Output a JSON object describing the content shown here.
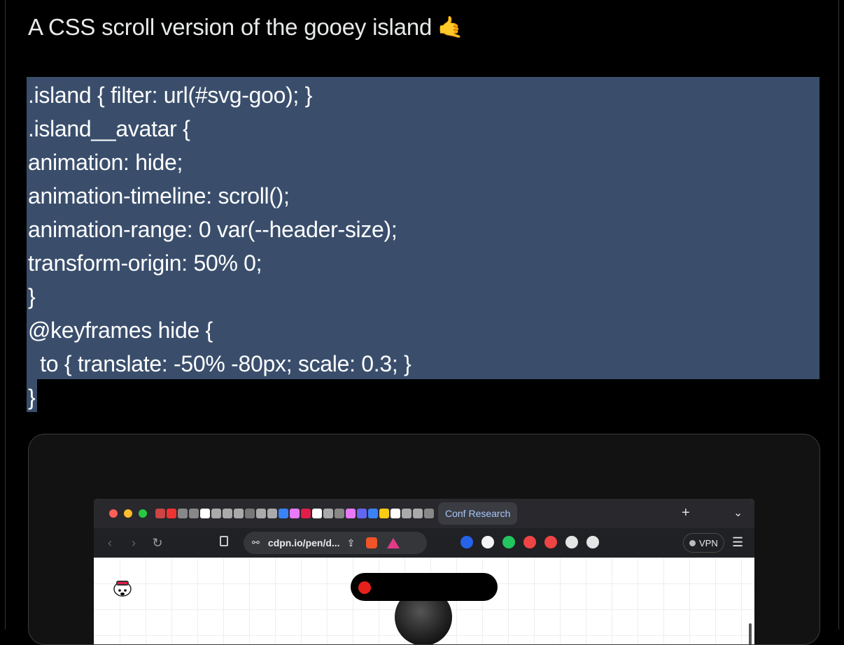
{
  "post": {
    "title": "A CSS scroll version of the gooey island",
    "emoji": "🤙"
  },
  "code_lines": [
    ".island { filter: url(#svg-goo); }",
    ".island__avatar {",
    "animation: hide;",
    "animation-timeline: scroll();",
    "animation-range: 0 var(--header-size);",
    "transform-origin: 50% 0;",
    "}",
    "@keyframes hide {",
    "  to { translate: -50% -80px; scale: 0.3; }",
    "}"
  ],
  "browser": {
    "active_tab_label": "Conf Research",
    "new_tab": "+",
    "tab_list": "⌄",
    "url": "cdpn.io/pen/d...",
    "vpn_label": "VPN",
    "nav": {
      "back": "‹",
      "forward": "›",
      "reload": "↻"
    }
  },
  "colors": {
    "selection": "#3a4e6c",
    "traffic": [
      "#ff5f57",
      "#febc2e",
      "#28c840"
    ],
    "tab_favicons": [
      "#c44",
      "#e33",
      "#888",
      "#888",
      "#fff",
      "#aaa",
      "#aaa",
      "#aaa",
      "#777",
      "#aaa",
      "#aaa",
      "#3b82f6",
      "#e879f9",
      "#e11d48",
      "#fff",
      "#aaa",
      "#888",
      "#e879f9",
      "#6366f1",
      "#3b82f6",
      "#facc15",
      "#fff",
      "#aaa",
      "#aaa",
      "#888"
    ],
    "extensions": [
      "#2563eb",
      "#f5f5f5",
      "#22c55e",
      "#ef4444",
      "#ef4444",
      "#e5e5e5",
      "#e5e5e5"
    ]
  }
}
